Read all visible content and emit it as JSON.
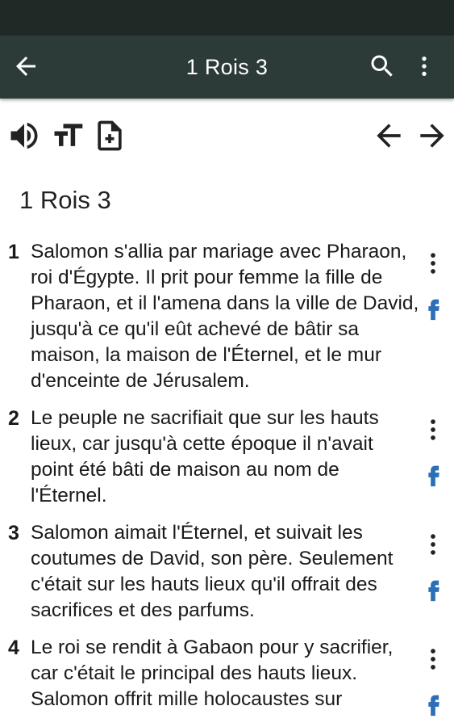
{
  "app_bar": {
    "title": "1 Rois 3",
    "back_icon": "arrow-back-icon",
    "search_icon": "search-icon",
    "more_icon": "more-vert-icon",
    "background": "#2c3b37"
  },
  "toolbar": {
    "icons": [
      "volume-icon",
      "text-size-icon",
      "add-note-icon",
      "arrow-back-icon",
      "arrow-forward-icon"
    ]
  },
  "chapter": {
    "heading": "1 Rois 3"
  },
  "verses": [
    {
      "number": "1",
      "text": "Salomon s'allia par mariage avec Pharaon, roi d'Égypte. Il prit pour femme la fille de Pharaon, et il l'amena dans la ville de David, jusqu'à ce qu'il eût achevé de bâtir sa maison, la maison de l'Éternel, et le mur d'enceinte de Jérusalem."
    },
    {
      "number": "2",
      "text": "Le peuple ne sacrifiait que sur les hauts lieux, car jusqu'à cette époque il n'avait point été bâti de maison au nom de l'Éternel."
    },
    {
      "number": "3",
      "text": "Salomon aimait l'Éternel, et suivait les coutumes de David, son père. Seulement c'était sur les hauts lieux qu'il offrait des sacrifices et des parfums."
    },
    {
      "number": "4",
      "text": "Le roi se rendit à Gabaon pour y sacrifier, car c'était le principal des hauts lieux. Salomon offrit mille holocaustes sur"
    }
  ],
  "colors": {
    "accent": "#2c6fb6",
    "icon": "#222222"
  }
}
